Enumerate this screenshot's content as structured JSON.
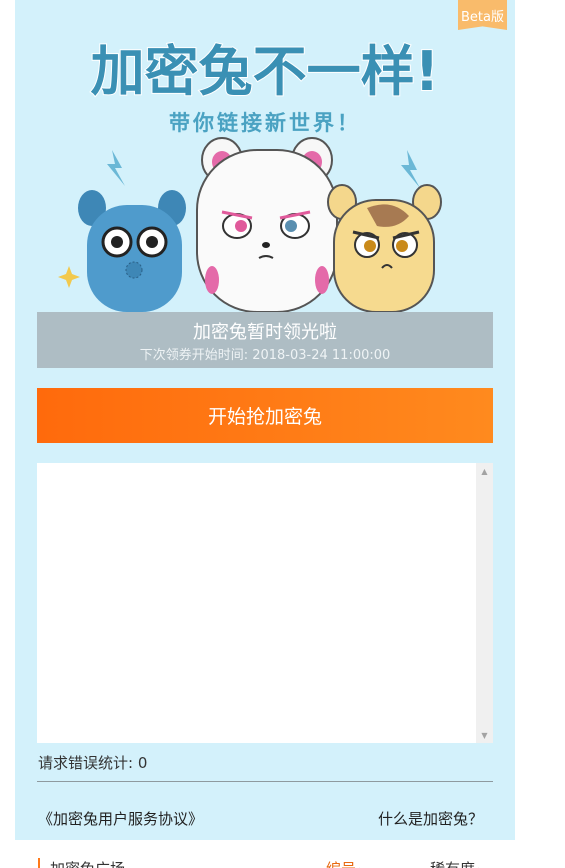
{
  "badge": {
    "beta": "Beta版"
  },
  "hero": {
    "title": "加密兔不一样!",
    "subtitle": "带你链接新世界！"
  },
  "notice": {
    "title": "加密兔暂时领光啦",
    "subtitle": "下次领券开始时间: 2018-03-24 11:00:00"
  },
  "actions": {
    "start_label": "开始抢加密兔"
  },
  "stats": {
    "error_label": "请求错误统计: 0"
  },
  "links": {
    "agreement": "《加密兔用户服务协议》",
    "what_is": "什么是加密兔？"
  },
  "market": {
    "title": "加密兔广场",
    "sort_number": "编号",
    "sort_rarity": "稀有度",
    "sort_arrow": "▲"
  },
  "colors": {
    "panel_bg": "#d3f1fb",
    "accent_orange": "#ff7a1a",
    "notice_bg": "#aebdc4",
    "title_blue": "#3a90b4"
  },
  "icons": {
    "scroll_up": "▲",
    "scroll_down": "▼"
  }
}
